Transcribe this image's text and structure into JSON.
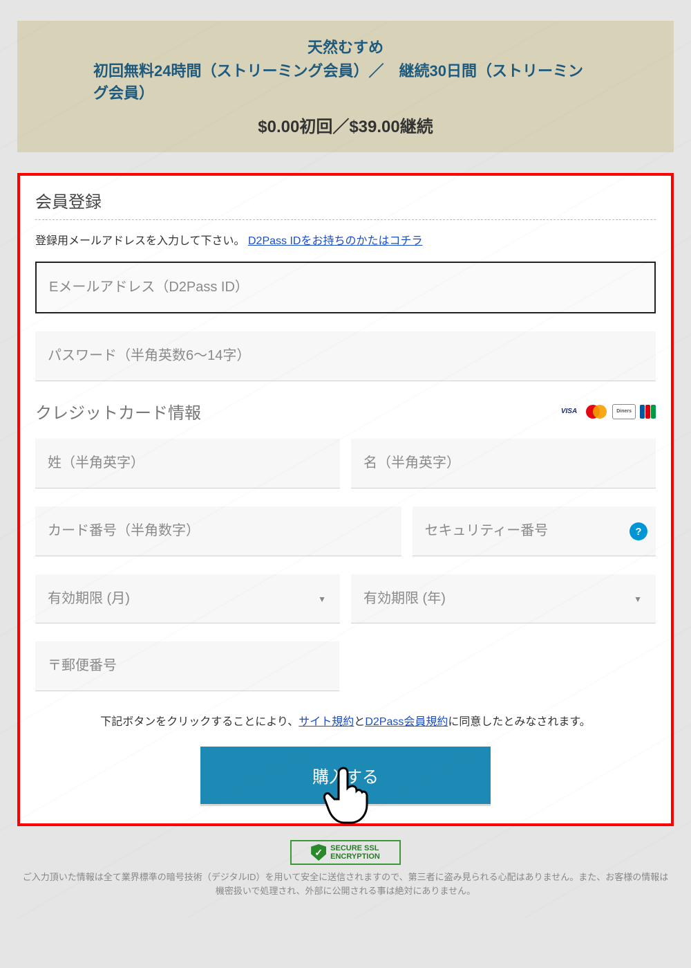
{
  "header": {
    "title": "天然むすめ",
    "subtitle": "初回無料24時間（ストリーミング会員）／　継続30日間（ストリーミング会員）",
    "price": "$0.00初回／$39.00継続"
  },
  "section1": {
    "title": "会員登録",
    "instruction_prefix": "登録用メールアドレスを入力して下さい。",
    "d2pass_link": "D2Pass IDをお持ちのかたはコチラ"
  },
  "fields": {
    "email_placeholder": "Eメールアドレス（D2Pass ID）",
    "password_placeholder": "パスワード（半角英数6～14字）",
    "cc_title": "クレジットカード情報",
    "lastname_placeholder": "姓（半角英字）",
    "firstname_placeholder": "名（半角英字）",
    "cardnumber_placeholder": "カード番号（半角数字）",
    "security_placeholder": "セキュリティー番号",
    "exp_month_placeholder": "有効期限 (月)",
    "exp_year_placeholder": "有効期限 (年)",
    "postal_placeholder": "〒郵便番号"
  },
  "cc_brands": {
    "visa": "VISA"
  },
  "consent": {
    "prefix": "下記ボタンをクリックすることにより、",
    "site_terms": "サイト規約",
    "middle": "と",
    "d2pass_terms": "D2Pass会員規約",
    "suffix": "に同意したとみなされます。"
  },
  "purchase_button": "購入する",
  "ssl": {
    "line1": "SECURE SSL",
    "line2": "ENCRYPTION"
  },
  "footer": "ご入力頂いた情報は全て業界標準の暗号技術（デジタルID）を用いて安全に送信されますので、第三者に盗み見られる心配はありません。また、お客様の情報は機密扱いで処理され、外部に公開される事は絶対にありません。",
  "help_icon": "?"
}
